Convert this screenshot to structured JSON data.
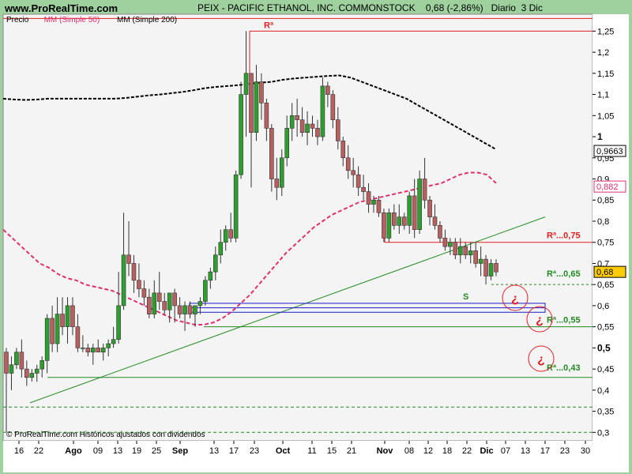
{
  "site": "www.ProRealTime.com",
  "title": "PEIX - PACIFIC ETHANOL, INC. COMMONSTOCK    0,68 (-2,86%)   Diario  3 Dic",
  "legend": [
    {
      "label": "Precio",
      "color": "#000000"
    },
    {
      "label": "MM (Simple 50)",
      "color": "#e0306f"
    },
    {
      "label": "MM (Simple 200)",
      "color": "#000000"
    }
  ],
  "copyright": "© ProRealTime.com  Históricos ajustados con dividendos",
  "colors": {
    "up": "#2e9e2e",
    "down": "#b86060",
    "resistance": "#e02020",
    "support": "#228b22",
    "ma50": "#e0306f",
    "ma200": "#000000",
    "box": "#1a1acc"
  },
  "chart_data": {
    "type": "candlestick",
    "ylim": [
      0.28,
      1.29
    ],
    "y_ticks": [
      "0,3",
      "0,35",
      "0,4",
      "0,45",
      "0,5",
      "0,55",
      "0,6",
      "0,65",
      "0,7",
      "0,75",
      "0,8",
      "0,85",
      "0,9",
      "0,95",
      "1",
      "1,05",
      "1,1",
      "1,15",
      "1,2",
      "1,25"
    ],
    "bold_ticks": [
      "0,5",
      "1"
    ],
    "x_ticks": [
      "16",
      "22",
      "Ago",
      "09",
      "13",
      "19",
      "25",
      "Sep",
      "13",
      "17",
      "23",
      "Oct",
      "11",
      "15",
      "21",
      "Nov",
      "08",
      "12",
      "18",
      "22",
      "Dic",
      "07",
      "13",
      "17",
      "23",
      "30"
    ],
    "bold_x_ticks": [
      "Ago",
      "Sep",
      "Oct",
      "Nov",
      "Dic"
    ],
    "price_badges": [
      {
        "value": 0.9663,
        "label": "0,9663",
        "color": "#000000"
      },
      {
        "value": 0.882,
        "label": "0,882",
        "color": "#e0306f"
      },
      {
        "value": 0.68,
        "label": "0,68",
        "color": "#ffcc00"
      }
    ],
    "candles": [
      {
        "o": 0.49,
        "h": 0.5,
        "l": 0.3,
        "c": 0.44
      },
      {
        "o": 0.44,
        "h": 0.48,
        "l": 0.4,
        "c": 0.46
      },
      {
        "o": 0.46,
        "h": 0.5,
        "l": 0.45,
        "c": 0.49
      },
      {
        "o": 0.49,
        "h": 0.52,
        "l": 0.43,
        "c": 0.45
      },
      {
        "o": 0.45,
        "h": 0.47,
        "l": 0.41,
        "c": 0.43
      },
      {
        "o": 0.43,
        "h": 0.45,
        "l": 0.42,
        "c": 0.44
      },
      {
        "o": 0.44,
        "h": 0.46,
        "l": 0.42,
        "c": 0.45
      },
      {
        "o": 0.45,
        "h": 0.48,
        "l": 0.43,
        "c": 0.47
      },
      {
        "o": 0.47,
        "h": 0.58,
        "l": 0.44,
        "c": 0.57
      },
      {
        "o": 0.57,
        "h": 0.6,
        "l": 0.49,
        "c": 0.51
      },
      {
        "o": 0.51,
        "h": 0.62,
        "l": 0.49,
        "c": 0.58
      },
      {
        "o": 0.58,
        "h": 0.62,
        "l": 0.53,
        "c": 0.55
      },
      {
        "o": 0.55,
        "h": 0.62,
        "l": 0.51,
        "c": 0.6
      },
      {
        "o": 0.6,
        "h": 0.62,
        "l": 0.53,
        "c": 0.55
      },
      {
        "o": 0.55,
        "h": 0.58,
        "l": 0.49,
        "c": 0.5
      },
      {
        "o": 0.5,
        "h": 0.53,
        "l": 0.49,
        "c": 0.5
      },
      {
        "o": 0.5,
        "h": 0.51,
        "l": 0.48,
        "c": 0.49
      },
      {
        "o": 0.49,
        "h": 0.51,
        "l": 0.46,
        "c": 0.5
      },
      {
        "o": 0.5,
        "h": 0.52,
        "l": 0.49,
        "c": 0.49
      },
      {
        "o": 0.49,
        "h": 0.51,
        "l": 0.47,
        "c": 0.5
      },
      {
        "o": 0.5,
        "h": 0.52,
        "l": 0.48,
        "c": 0.51
      },
      {
        "o": 0.51,
        "h": 0.55,
        "l": 0.5,
        "c": 0.52
      },
      {
        "o": 0.52,
        "h": 0.68,
        "l": 0.51,
        "c": 0.6
      },
      {
        "o": 0.6,
        "h": 0.82,
        "l": 0.59,
        "c": 0.72
      },
      {
        "o": 0.72,
        "h": 0.8,
        "l": 0.67,
        "c": 0.7
      },
      {
        "o": 0.7,
        "h": 0.72,
        "l": 0.63,
        "c": 0.66
      },
      {
        "o": 0.66,
        "h": 0.7,
        "l": 0.62,
        "c": 0.64
      },
      {
        "o": 0.64,
        "h": 0.66,
        "l": 0.6,
        "c": 0.62
      },
      {
        "o": 0.62,
        "h": 0.64,
        "l": 0.57,
        "c": 0.58
      },
      {
        "o": 0.58,
        "h": 0.66,
        "l": 0.57,
        "c": 0.63
      },
      {
        "o": 0.63,
        "h": 0.68,
        "l": 0.59,
        "c": 0.61
      },
      {
        "o": 0.61,
        "h": 0.63,
        "l": 0.58,
        "c": 0.59
      },
      {
        "o": 0.59,
        "h": 0.61,
        "l": 0.56,
        "c": 0.63
      },
      {
        "o": 0.63,
        "h": 0.64,
        "l": 0.56,
        "c": 0.6
      },
      {
        "o": 0.6,
        "h": 0.62,
        "l": 0.57,
        "c": 0.58
      },
      {
        "o": 0.58,
        "h": 0.61,
        "l": 0.54,
        "c": 0.6
      },
      {
        "o": 0.6,
        "h": 0.61,
        "l": 0.57,
        "c": 0.58
      },
      {
        "o": 0.58,
        "h": 0.6,
        "l": 0.55,
        "c": 0.6
      },
      {
        "o": 0.6,
        "h": 0.62,
        "l": 0.58,
        "c": 0.61
      },
      {
        "o": 0.61,
        "h": 0.67,
        "l": 0.6,
        "c": 0.66
      },
      {
        "o": 0.66,
        "h": 0.69,
        "l": 0.64,
        "c": 0.68
      },
      {
        "o": 0.68,
        "h": 0.74,
        "l": 0.66,
        "c": 0.72
      },
      {
        "o": 0.72,
        "h": 0.78,
        "l": 0.7,
        "c": 0.75
      },
      {
        "o": 0.75,
        "h": 0.79,
        "l": 0.73,
        "c": 0.78
      },
      {
        "o": 0.78,
        "h": 0.82,
        "l": 0.75,
        "c": 0.76
      },
      {
        "o": 0.76,
        "h": 0.92,
        "l": 0.75,
        "c": 0.91
      },
      {
        "o": 0.91,
        "h": 1.13,
        "l": 0.9,
        "c": 1.1
      },
      {
        "o": 1.1,
        "h": 1.25,
        "l": 1.0,
        "c": 1.15
      },
      {
        "o": 1.15,
        "h": 1.15,
        "l": 0.88,
        "c": 1.01
      },
      {
        "o": 1.01,
        "h": 1.17,
        "l": 0.99,
        "c": 1.13
      },
      {
        "o": 1.13,
        "h": 1.15,
        "l": 1.04,
        "c": 1.08
      },
      {
        "o": 1.08,
        "h": 1.09,
        "l": 0.99,
        "c": 1.02
      },
      {
        "o": 1.02,
        "h": 1.03,
        "l": 0.87,
        "c": 0.9
      },
      {
        "o": 0.9,
        "h": 0.95,
        "l": 0.85,
        "c": 0.88
      },
      {
        "o": 0.88,
        "h": 0.97,
        "l": 0.86,
        "c": 0.95
      },
      {
        "o": 0.95,
        "h": 1.05,
        "l": 0.93,
        "c": 1.02
      },
      {
        "o": 1.02,
        "h": 1.08,
        "l": 0.99,
        "c": 1.05
      },
      {
        "o": 1.05,
        "h": 1.09,
        "l": 1.0,
        "c": 1.04
      },
      {
        "o": 1.04,
        "h": 1.07,
        "l": 1.0,
        "c": 1.01
      },
      {
        "o": 1.01,
        "h": 1.06,
        "l": 0.98,
        "c": 1.03
      },
      {
        "o": 1.03,
        "h": 1.05,
        "l": 1.0,
        "c": 1.02
      },
      {
        "o": 1.02,
        "h": 1.04,
        "l": 0.98,
        "c": 1.0
      },
      {
        "o": 1.0,
        "h": 1.14,
        "l": 0.99,
        "c": 1.12
      },
      {
        "o": 1.12,
        "h": 1.13,
        "l": 1.07,
        "c": 1.1
      },
      {
        "o": 1.1,
        "h": 1.11,
        "l": 1.02,
        "c": 1.04
      },
      {
        "o": 1.04,
        "h": 1.07,
        "l": 0.97,
        "c": 0.99
      },
      {
        "o": 0.99,
        "h": 1.0,
        "l": 0.93,
        "c": 0.95
      },
      {
        "o": 0.95,
        "h": 0.98,
        "l": 0.9,
        "c": 0.92
      },
      {
        "o": 0.92,
        "h": 0.95,
        "l": 0.88,
        "c": 0.91
      },
      {
        "o": 0.91,
        "h": 0.93,
        "l": 0.86,
        "c": 0.88
      },
      {
        "o": 0.88,
        "h": 0.91,
        "l": 0.85,
        "c": 0.87
      },
      {
        "o": 0.87,
        "h": 0.89,
        "l": 0.82,
        "c": 0.84
      },
      {
        "o": 0.84,
        "h": 0.86,
        "l": 0.82,
        "c": 0.85
      },
      {
        "o": 0.85,
        "h": 0.86,
        "l": 0.81,
        "c": 0.82
      },
      {
        "o": 0.82,
        "h": 0.83,
        "l": 0.75,
        "c": 0.76
      },
      {
        "o": 0.76,
        "h": 0.83,
        "l": 0.75,
        "c": 0.82
      },
      {
        "o": 0.82,
        "h": 0.84,
        "l": 0.78,
        "c": 0.79
      },
      {
        "o": 0.79,
        "h": 0.84,
        "l": 0.77,
        "c": 0.81
      },
      {
        "o": 0.81,
        "h": 0.82,
        "l": 0.78,
        "c": 0.79
      },
      {
        "o": 0.79,
        "h": 0.87,
        "l": 0.77,
        "c": 0.86
      },
      {
        "o": 0.86,
        "h": 0.9,
        "l": 0.76,
        "c": 0.78
      },
      {
        "o": 0.78,
        "h": 0.92,
        "l": 0.77,
        "c": 0.9
      },
      {
        "o": 0.9,
        "h": 0.95,
        "l": 0.83,
        "c": 0.85
      },
      {
        "o": 0.85,
        "h": 0.86,
        "l": 0.79,
        "c": 0.81
      },
      {
        "o": 0.81,
        "h": 0.84,
        "l": 0.78,
        "c": 0.79
      },
      {
        "o": 0.79,
        "h": 0.8,
        "l": 0.75,
        "c": 0.76
      },
      {
        "o": 0.76,
        "h": 0.78,
        "l": 0.73,
        "c": 0.74
      },
      {
        "o": 0.74,
        "h": 0.76,
        "l": 0.72,
        "c": 0.75
      },
      {
        "o": 0.75,
        "h": 0.76,
        "l": 0.71,
        "c": 0.72
      },
      {
        "o": 0.72,
        "h": 0.76,
        "l": 0.7,
        "c": 0.74
      },
      {
        "o": 0.74,
        "h": 0.75,
        "l": 0.71,
        "c": 0.72
      },
      {
        "o": 0.72,
        "h": 0.75,
        "l": 0.7,
        "c": 0.73
      },
      {
        "o": 0.73,
        "h": 0.75,
        "l": 0.69,
        "c": 0.7
      },
      {
        "o": 0.7,
        "h": 0.74,
        "l": 0.67,
        "c": 0.71
      },
      {
        "o": 0.71,
        "h": 0.72,
        "l": 0.65,
        "c": 0.67
      },
      {
        "o": 0.67,
        "h": 0.71,
        "l": 0.66,
        "c": 0.7
      },
      {
        "o": 0.7,
        "h": 0.71,
        "l": 0.67,
        "c": 0.68
      }
    ],
    "ma50": [
      0.78,
      0.76,
      0.74,
      0.72,
      0.7,
      0.69,
      0.675,
      0.665,
      0.66,
      0.65,
      0.645,
      0.64,
      0.635,
      0.625,
      0.615,
      0.605,
      0.595,
      0.585,
      0.575,
      0.565,
      0.56,
      0.555,
      0.555,
      0.56,
      0.57,
      0.585,
      0.605,
      0.625,
      0.65,
      0.675,
      0.7,
      0.725,
      0.745,
      0.765,
      0.785,
      0.8,
      0.815,
      0.825,
      0.835,
      0.845,
      0.85,
      0.855,
      0.86,
      0.865,
      0.87,
      0.875,
      0.88,
      0.885,
      0.89,
      0.9,
      0.91,
      0.915,
      0.915,
      0.91,
      0.89
    ],
    "ma200": [
      1.09,
      1.088,
      1.087,
      1.088,
      1.09,
      1.09,
      1.09,
      1.09,
      1.09,
      1.09,
      1.09,
      1.092,
      1.095,
      1.098,
      1.1,
      1.103,
      1.106,
      1.11,
      1.115,
      1.118,
      1.12,
      1.122,
      1.125,
      1.128,
      1.13,
      1.135,
      1.138,
      1.14,
      1.142,
      1.144,
      1.145,
      1.14,
      1.13,
      1.12,
      1.11,
      1.1,
      1.09,
      1.075,
      1.06,
      1.045,
      1.03,
      1.015,
      1.0,
      0.985,
      0.97
    ],
    "levels": [
      {
        "label": "Rª",
        "value": 1.25,
        "color": "#e02020",
        "style": "solid"
      },
      {
        "label": "Rª...0,75",
        "value": 0.75,
        "color": "#e02020",
        "style": "solid"
      },
      {
        "label": "Rª...0,65",
        "value": 0.65,
        "color": "#228b22",
        "style": "dashed"
      },
      {
        "label": "Rª...0,55",
        "value": 0.55,
        "color": "#228b22",
        "style": "solid"
      },
      {
        "label": "Rª...0,43",
        "value": 0.43,
        "color": "#228b22",
        "style": "solid"
      }
    ],
    "extra_lines": [
      {
        "value": 1.28,
        "color": "#e02020"
      },
      {
        "value": 0.36,
        "color": "#228b22",
        "dashed": true
      },
      {
        "value": 0.3,
        "color": "#228b22",
        "dashed": true
      }
    ],
    "support_zone": {
      "label": "S",
      "low": 0.59,
      "high": 0.6
    },
    "trendline": {
      "from": 0.37,
      "to": 0.81
    },
    "annotations": [
      "¿",
      "¿",
      "¿"
    ]
  }
}
